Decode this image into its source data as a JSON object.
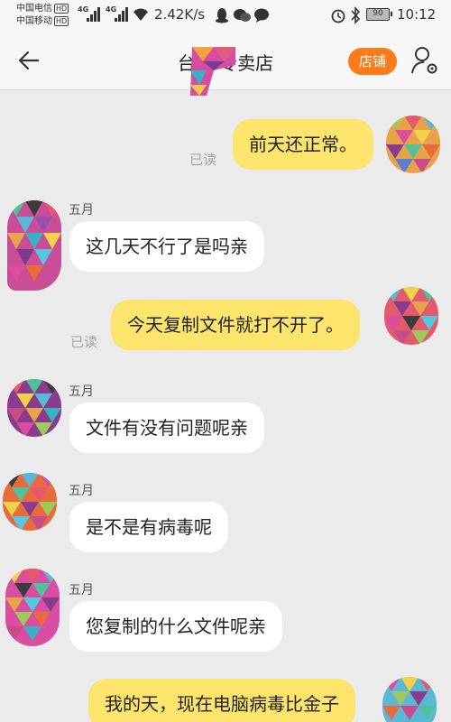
{
  "status_bar": {
    "carrier1": "中国电信",
    "carrier2": "中国移动",
    "hd": "HD",
    "net1": "4G",
    "net2": "4G",
    "speed": "2.42K/s",
    "battery": "90",
    "time": "10:12"
  },
  "header": {
    "title": "台电 专卖店",
    "shop_button": "店铺"
  },
  "chat": {
    "read_label": "已读",
    "messages": [
      {
        "side": "out",
        "text": "前天还正常。"
      },
      {
        "side": "in",
        "sender": "五月",
        "text": "这几天不行了是吗亲"
      },
      {
        "side": "out",
        "text": "今天复制文件就打不开了。"
      },
      {
        "side": "in",
        "sender": "五月",
        "text": "文件有没有问题呢亲"
      },
      {
        "side": "in",
        "sender": "五月",
        "text": "是不是有病毒呢"
      },
      {
        "side": "in",
        "sender": "五月",
        "text": "您复制的什么文件呢亲"
      },
      {
        "side": "out",
        "text": "我的天，现在电脑病毒比金子"
      }
    ]
  },
  "colors": {
    "background": "#ebebeb",
    "out_bubble": "#fde46d",
    "in_bubble": "#ffffff",
    "shop_button": "#ff7b1a"
  }
}
